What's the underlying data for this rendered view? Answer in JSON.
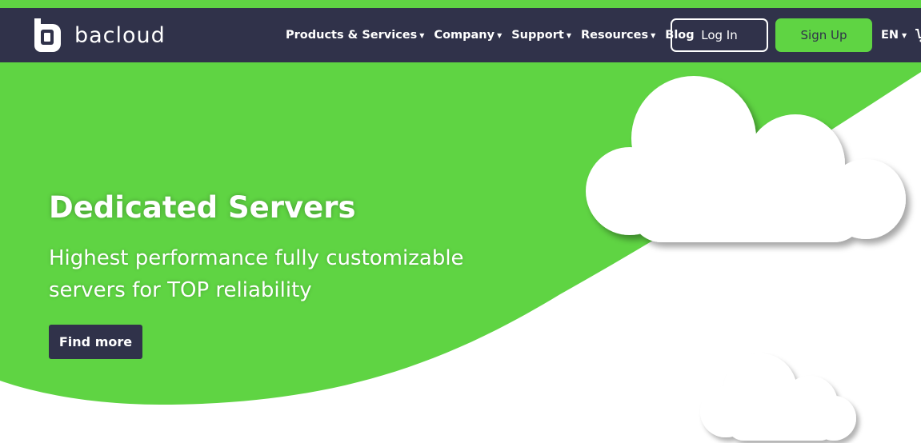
{
  "brand": {
    "name": "bacloud"
  },
  "colors": {
    "accent": "#5fd443",
    "navbar": "#30324a",
    "text_light": "#ffffff"
  },
  "nav": {
    "items": [
      {
        "label": "Products & Services",
        "has_dropdown": true
      },
      {
        "label": "Company",
        "has_dropdown": true
      },
      {
        "label": "Support",
        "has_dropdown": true
      },
      {
        "label": "Resources",
        "has_dropdown": true
      },
      {
        "label": "Blog",
        "has_dropdown": false
      }
    ],
    "login_label": "Log In",
    "signup_label": "Sign Up",
    "language": "EN",
    "caret": "▼"
  },
  "hero": {
    "title": "Dedicated Servers",
    "subtitle": "Highest performance fully customizable servers for TOP reliability",
    "cta_label": "Find more"
  },
  "icons": [
    "logo-icon",
    "caret-down-icon",
    "cart-icon",
    "cloud-illustration"
  ]
}
